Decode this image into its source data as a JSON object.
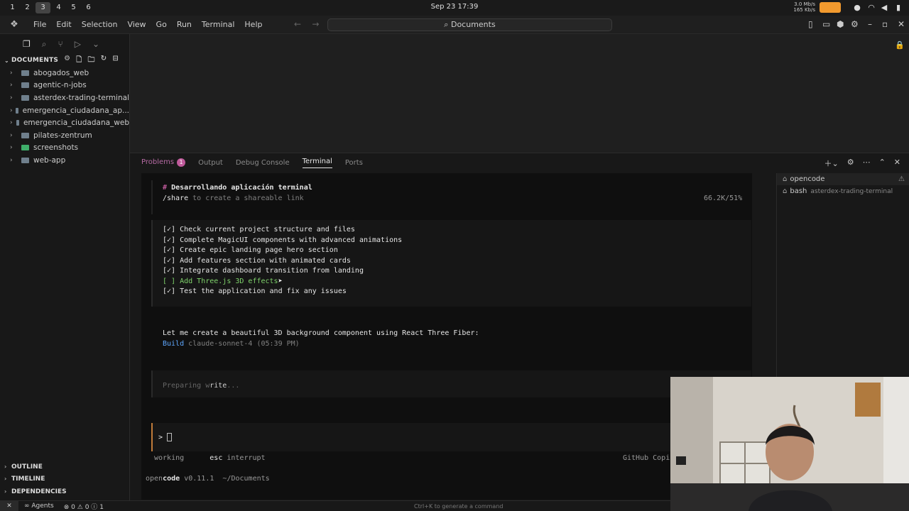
{
  "system": {
    "workspaces": [
      "1",
      "2",
      "3",
      "4",
      "5",
      "6"
    ],
    "active_workspace": "3",
    "clock": "Sep 23  17:39",
    "net_up": "3.0 Mb/s",
    "net_down": "165 Kb/s"
  },
  "menubar": {
    "items": [
      "File",
      "Edit",
      "Selection",
      "View",
      "Go",
      "Run",
      "Terminal",
      "Help"
    ],
    "search": "Documents"
  },
  "sidebar": {
    "header": "DOCUMENTS",
    "folders": [
      {
        "name": "abogados_web"
      },
      {
        "name": "agentic-n-jobs"
      },
      {
        "name": "asterdex-trading-terminal"
      },
      {
        "name": "emergencia_ciudadana_ap..."
      },
      {
        "name": "emergencia_ciudadana_web"
      },
      {
        "name": "pilates-zentrum"
      },
      {
        "name": "screenshots"
      },
      {
        "name": "web-app"
      }
    ],
    "sections": [
      "OUTLINE",
      "TIMELINE",
      "DEPENDENCIES"
    ]
  },
  "panel": {
    "tabs": [
      "Problems",
      "Output",
      "Debug Console",
      "Terminal",
      "Ports"
    ],
    "problems_count": "1",
    "active_tab": "Terminal"
  },
  "terminal": {
    "heading_hash": "#",
    "heading": "Desarrollando aplicación terminal",
    "share_cmd": "/share",
    "share_rest": " to create a shareable link",
    "usage": "66.2K/51%",
    "todos": [
      {
        "mark": "[✓]",
        "text": "Check current project structure and files"
      },
      {
        "mark": "[✓]",
        "text": "Complete MagicUI components with advanced animations"
      },
      {
        "mark": "[✓]",
        "text": "Create epic landing page hero section"
      },
      {
        "mark": "[✓]",
        "text": "Add features section with animated cards"
      },
      {
        "mark": "[✓]",
        "text": "Integrate dashboard transition from landing"
      },
      {
        "mark": "[ ]",
        "text": "Add Three.js 3D effects"
      },
      {
        "mark": "[✓]",
        "text": "Test the application and fix any issues"
      }
    ],
    "message": "Let me create a beautiful 3D background component using React Three Fiber:",
    "build_label": "Build",
    "build_meta": "claude-sonnet-4 (05:39 PM)",
    "preparing_a": "Preparing w",
    "preparing_b": "rite",
    "preparing_c": "...",
    "prompt": ">",
    "working": "working",
    "esc": "esc",
    "interrupt": "interrupt",
    "copilot": "GitHub Copi",
    "app_a": "open",
    "app_b": "code",
    "version": "v0.11.1",
    "cwd": "~/Documents"
  },
  "terminal_list": [
    {
      "name": "opencode",
      "sub": ""
    },
    {
      "name": "bash",
      "sub": "asterdex-trading-terminal"
    }
  ],
  "statusbar": {
    "agents": "Agents",
    "errors": "0",
    "warnings": "0",
    "info": "1",
    "hint": "Ctrl+K to generate a command"
  },
  "colors": {
    "todo_done": "#e6e6e6",
    "todo_pending": "#7fd36b",
    "build": "#5fa8ff",
    "accent": "#c05a9b"
  }
}
